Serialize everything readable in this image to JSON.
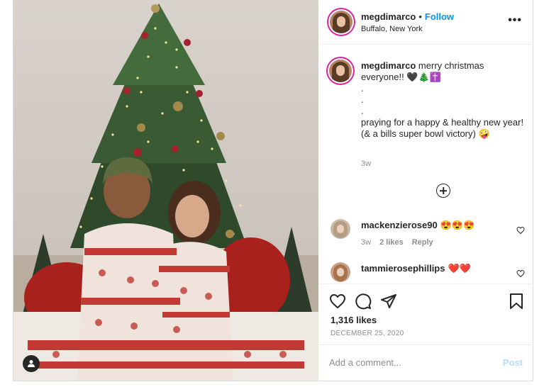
{
  "post": {
    "username": "megdimarco",
    "follow_separator": "•",
    "follow_label": "Follow",
    "location": "Buffalo, New York",
    "more_icon": "more-dots-icon",
    "more_label": "•••"
  },
  "caption": {
    "username": "megdimarco",
    "text": " merry christmas everyone!! 🖤🎄✝️\n.\n.\n.\npraying for a happy & healthy new year!\n(& a bills super bowl victory) 🤪",
    "time": "3w"
  },
  "comments": [
    {
      "username": "mackenzierose90",
      "emoji": "😍😍😍",
      "time": "3w",
      "likes": "2 likes",
      "reply": "Reply"
    },
    {
      "username": "tammierosephillips",
      "emoji": "❤️❤️"
    }
  ],
  "actions": {
    "likes": "1,316 likes",
    "date": "DECEMBER 25, 2020",
    "icons": [
      "heart-icon",
      "comment-icon",
      "share-icon",
      "bookmark-icon"
    ]
  },
  "add_comment": {
    "placeholder": "Add a comment...",
    "post_label": "Post"
  },
  "colors": {
    "accent": "#0095f6",
    "post_disabled": "#b2dffc",
    "story_ring": "#d6249f",
    "secondary_text": "#8e8e8e"
  }
}
